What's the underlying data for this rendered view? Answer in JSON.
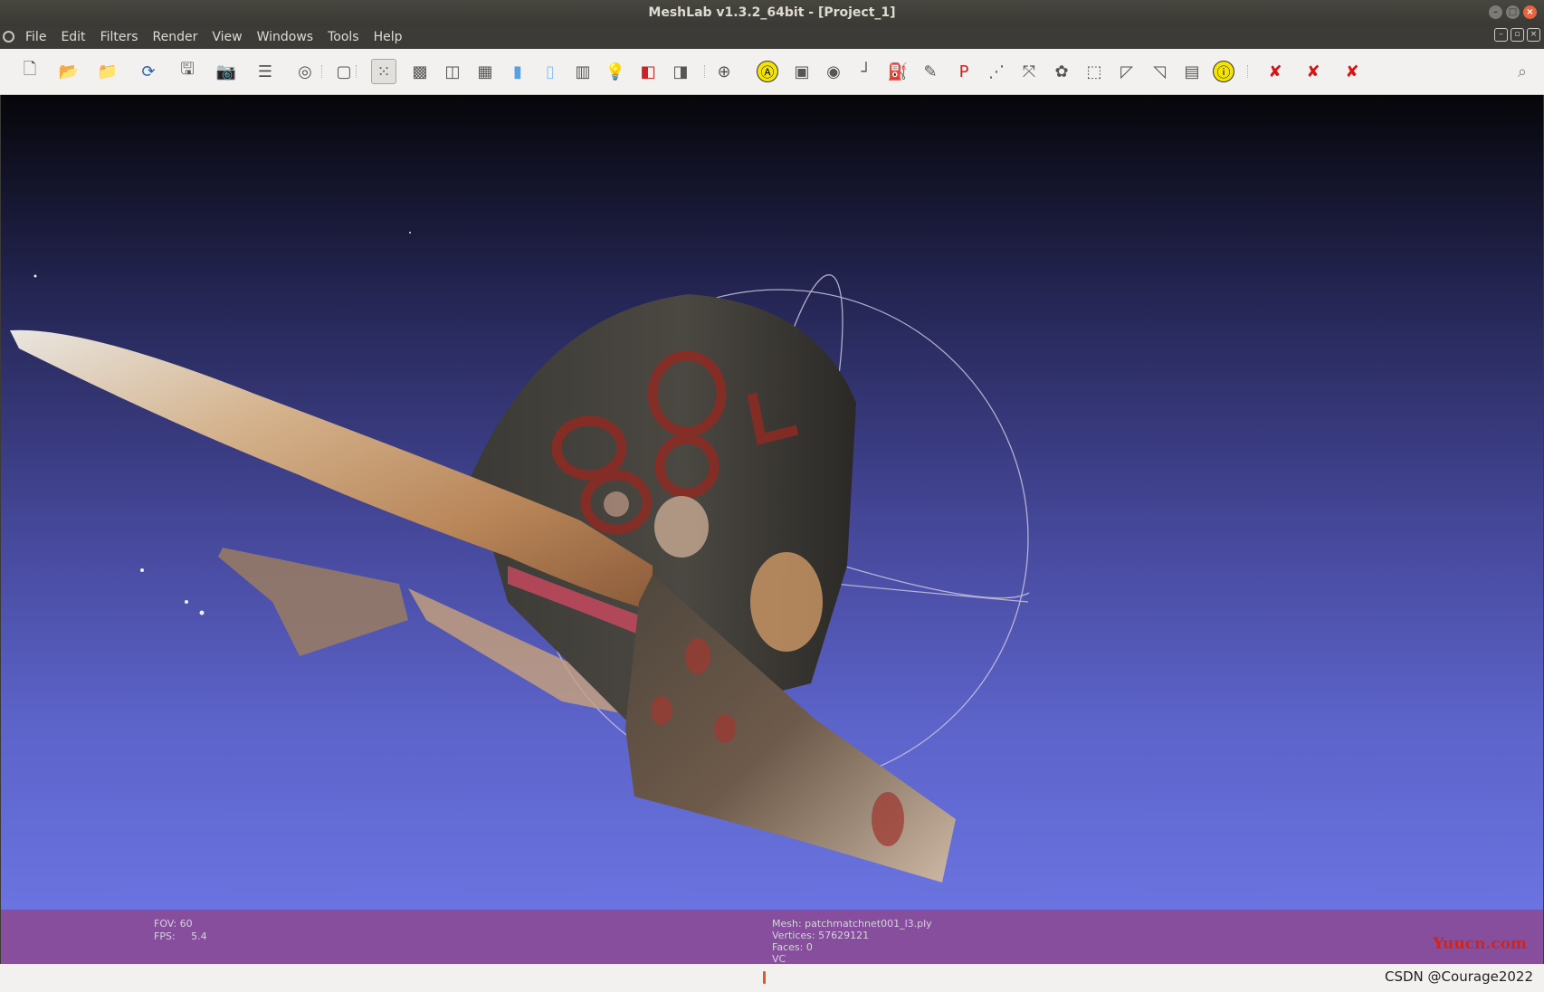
{
  "window": {
    "title": "MeshLab v1.3.2_64bit - [Project_1]"
  },
  "menu": [
    "File",
    "Edit",
    "Filters",
    "Render",
    "View",
    "Windows",
    "Tools",
    "Help"
  ],
  "toolbar": {
    "buttons": [
      {
        "name": "new-project-icon",
        "glyph": "🗋"
      },
      {
        "name": "open-project-icon",
        "glyph": "📂"
      },
      {
        "name": "import-mesh-icon",
        "glyph": "📁"
      },
      {
        "name": "reload-icon",
        "glyph": "⟳"
      },
      {
        "name": "save-icon",
        "glyph": "🖫"
      },
      {
        "name": "snapshot-icon",
        "glyph": "📷"
      },
      {
        "name": "layers-icon",
        "glyph": "☰"
      },
      {
        "name": "raster-icon",
        "glyph": "◎"
      },
      {
        "name": "bbox-icon",
        "glyph": "▢"
      },
      {
        "name": "points-icon",
        "glyph": "⁙"
      },
      {
        "name": "wireframe-icon",
        "glyph": "▩"
      },
      {
        "name": "hidden-lines-icon",
        "glyph": "◫"
      },
      {
        "name": "flat-lines-icon",
        "glyph": "▦"
      },
      {
        "name": "flat-icon",
        "glyph": "▮"
      },
      {
        "name": "smooth-icon",
        "glyph": "▯"
      },
      {
        "name": "texture-icon",
        "glyph": "▥"
      },
      {
        "name": "light-icon",
        "glyph": "💡"
      },
      {
        "name": "backface-icon",
        "glyph": "◧"
      },
      {
        "name": "double-side-icon",
        "glyph": "◨"
      },
      {
        "name": "trackball-icon",
        "glyph": "⊕"
      },
      {
        "name": "annotate-icon",
        "glyph": "Ⓐ"
      },
      {
        "name": "shader-icon",
        "glyph": "▣"
      },
      {
        "name": "sphere-icon",
        "glyph": "◉"
      },
      {
        "name": "axes-icon",
        "glyph": "┘"
      },
      {
        "name": "paint-bucket-icon",
        "glyph": "⛽"
      },
      {
        "name": "brush-icon",
        "glyph": "✎"
      },
      {
        "name": "pickpoints-icon",
        "glyph": "P"
      },
      {
        "name": "measure-icon",
        "glyph": "⋰"
      },
      {
        "name": "align-icon",
        "glyph": "⤧"
      },
      {
        "name": "color-icon",
        "glyph": "✿"
      },
      {
        "name": "select-icon",
        "glyph": "⬚"
      },
      {
        "name": "select-faces-icon",
        "glyph": "◸"
      },
      {
        "name": "select-vertices-icon",
        "glyph": "◹"
      },
      {
        "name": "image-icon",
        "glyph": "▤"
      },
      {
        "name": "info-icon",
        "glyph": "ⓘ"
      },
      {
        "name": "delete-faces-icon",
        "glyph": "✘"
      },
      {
        "name": "delete-vertices-icon",
        "glyph": "✘"
      },
      {
        "name": "delete-all-icon",
        "glyph": "✘"
      },
      {
        "name": "search-icon",
        "glyph": "⌕"
      }
    ]
  },
  "viewport": {
    "fov_label": "FOV:",
    "fov": "60",
    "fps_label": "FPS:",
    "fps": "5.4",
    "mesh_label": "Mesh:",
    "mesh_name": "patchmatchnet001_l3.ply",
    "vertices_label": "Vertices:",
    "vertices": "57629121",
    "faces_label": "Faces:",
    "faces": "0",
    "vc": "VC",
    "watermark": "Yuucn.com"
  },
  "statusbar": {
    "credit": "CSDN @Courage2022"
  }
}
